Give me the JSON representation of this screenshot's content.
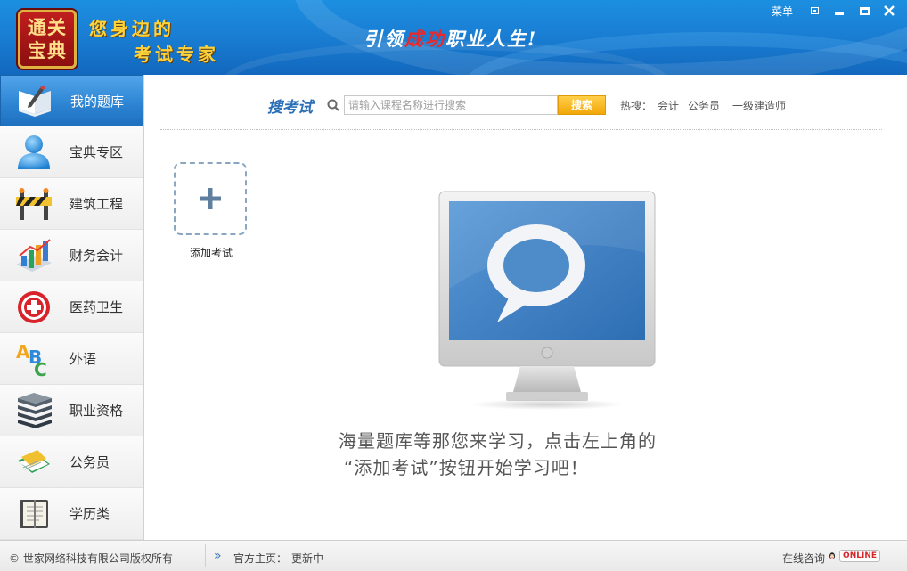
{
  "header": {
    "logo_line1": "通关",
    "logo_line2": "宝典",
    "slogan_line1": "您身边的",
    "slogan_line2": "考试专家",
    "tagline_a": "引领",
    "tagline_b": "成功",
    "tagline_c": "职业人生!",
    "menu_label": "菜单"
  },
  "sidebar": {
    "items": [
      {
        "label": "我的题库",
        "icon": "book-pen-icon",
        "active": true
      },
      {
        "label": "宝典专区",
        "icon": "user-icon"
      },
      {
        "label": "建筑工程",
        "icon": "construction-barrier-icon"
      },
      {
        "label": "财务会计",
        "icon": "bar-chart-icon"
      },
      {
        "label": "医药卫生",
        "icon": "medical-cross-icon"
      },
      {
        "label": "外语",
        "icon": "abc-icon"
      },
      {
        "label": "职业资格",
        "icon": "book-stack-icon"
      },
      {
        "label": "公务员",
        "icon": "documents-icon"
      },
      {
        "label": "学历类",
        "icon": "notebook-icon"
      }
    ]
  },
  "search": {
    "title": "搜考试",
    "placeholder": "请输入课程名称进行搜索",
    "button": "搜索",
    "hot_label": "热搜：",
    "hot_items": [
      "会计",
      "公务员",
      "一级建造师"
    ]
  },
  "main": {
    "add_exam_label": "添加考试",
    "hint_line1": "海量题库等那您来学习，点击左上角的",
    "hint_line2": "“添加考试”按钮开始学习吧！"
  },
  "footer": {
    "copyright": "© 世家网络科技有限公司版权所有",
    "homepage_label": "官方主页：",
    "homepage_value": "更新中",
    "consult_label": "在线咨询",
    "online_badge": "ONLINE"
  },
  "colors": {
    "header_blue": "#1a7fd4",
    "active_item": "#2b83d2",
    "search_button": "#f2a708",
    "title_blue": "#2b6fb7",
    "accent_red": "#e8292c"
  }
}
